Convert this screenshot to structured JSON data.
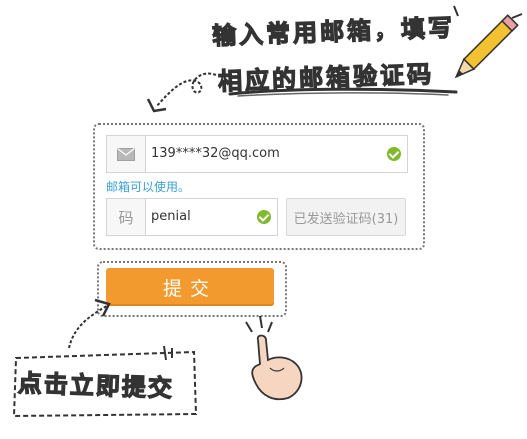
{
  "hint": {
    "line1": "输入常用邮箱，填写",
    "line2": "相应的邮箱验证码"
  },
  "email_row": {
    "icon": "envelope-icon",
    "value": "139****32@qq.com",
    "valid": true
  },
  "email_status": "邮箱可以使用。",
  "code_row": {
    "label": "码",
    "value": "penial",
    "valid": true
  },
  "send_code_button": {
    "label": "已发送验证码(31)"
  },
  "submit_button": {
    "label": "提交"
  },
  "bottom_hint": "点击立即提交",
  "colors": {
    "accent_orange": "#f39a2e",
    "status_blue": "#3a9fd8",
    "check_green": "#7fba2e"
  }
}
